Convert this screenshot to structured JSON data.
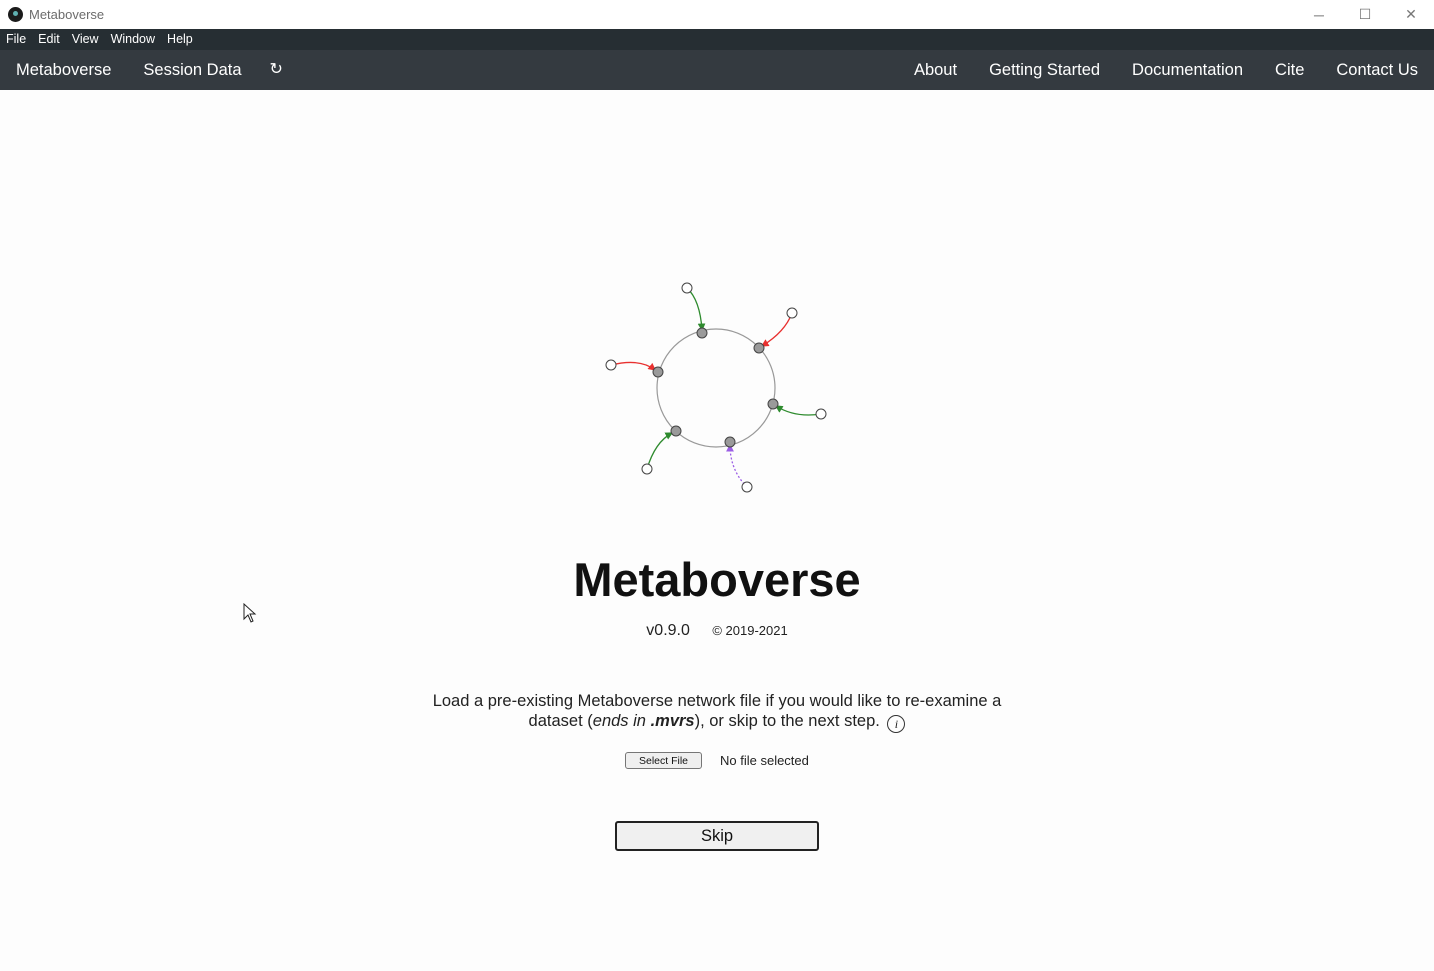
{
  "window": {
    "title": "Metaboverse",
    "controls": {
      "minimize": "─",
      "maximize": "☐",
      "close": "✕"
    }
  },
  "menubar": {
    "items": [
      "File",
      "Edit",
      "View",
      "Window",
      "Help"
    ]
  },
  "navbar": {
    "left": [
      "Metaboverse",
      "Session Data"
    ],
    "refresh_icon": "↻",
    "right": [
      "About",
      "Getting Started",
      "Documentation",
      "Cite",
      "Contact Us"
    ]
  },
  "main": {
    "app_name": "Metaboverse",
    "version": "v0.9.0",
    "copyright": "© 2019-2021",
    "instructions": {
      "part1": "Load a pre-existing Metaboverse network file if you would like to re-examine a dataset (",
      "ends_in": "ends in ",
      "extension": ".mvrs",
      "part2": "), or skip to the next step.",
      "info_icon": "i"
    },
    "select_file_label": "Select File",
    "file_status": "No file selected",
    "skip_label": "Skip"
  },
  "colors": {
    "navbar_bg": "#343a40",
    "menubar_bg": "#262e33",
    "edge_green": "#2e8b2e",
    "edge_red": "#e8302f",
    "edge_purple": "#9b5de5"
  }
}
